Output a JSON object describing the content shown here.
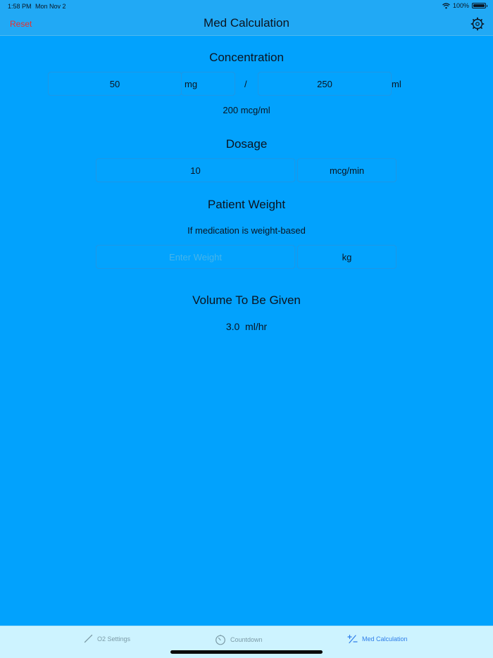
{
  "status": {
    "time": "1:58 PM",
    "date": "Mon Nov 2",
    "battery": "100%"
  },
  "nav": {
    "reset": "Reset",
    "title": "Med Calculation",
    "settings_icon": "gear-icon"
  },
  "concentration": {
    "heading": "Concentration",
    "amount": "50",
    "amount_unit": "mg",
    "separator": "/",
    "volume": "250",
    "volume_unit": "ml",
    "result": "200 mcg/ml"
  },
  "dosage": {
    "heading": "Dosage",
    "value": "10",
    "unit": "mcg/min"
  },
  "weight": {
    "heading": "Patient Weight",
    "note": "If medication is weight-based",
    "placeholder": "Enter Weight",
    "unit": "kg"
  },
  "volume": {
    "heading": "Volume To Be Given",
    "result": "3.0  ml/hr"
  },
  "tabs": [
    {
      "label": "O2 Settings",
      "icon": "pencil-icon"
    },
    {
      "label": "Countdown",
      "icon": "timer-icon"
    },
    {
      "label": "Med Calculation",
      "icon": "plus-minus-icon"
    }
  ],
  "colors": {
    "background": "#02a2fd",
    "reset": "#e8322e",
    "active_tab": "#2e7de9"
  }
}
